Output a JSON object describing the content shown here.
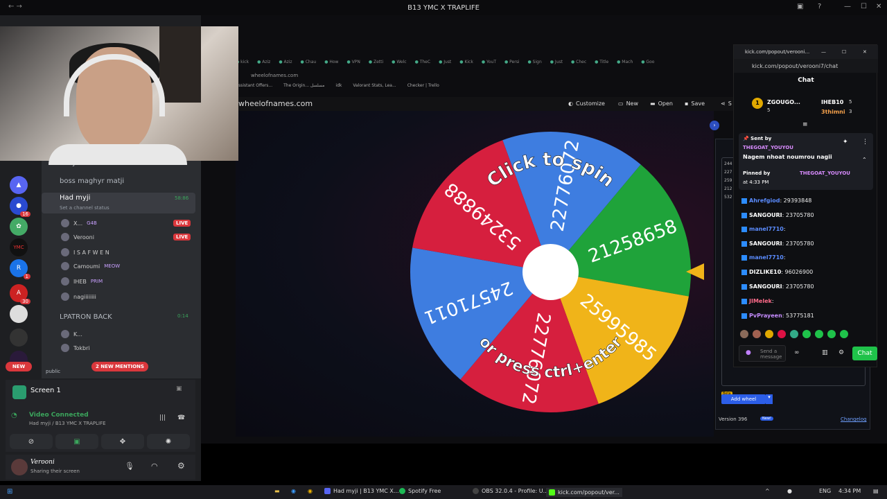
{
  "window": {
    "title": "B13 YMC X TRAPLIFE"
  },
  "discord": {
    "server_badges": [
      "16",
      "1",
      "30",
      "NEW"
    ],
    "channels": {
      "text1": "daily-task",
      "text2": "boss maghyr matji",
      "voice_active": "Had myji",
      "voice_active_time": "58:86",
      "voice_status": "Set a channel status",
      "voice2": "LPATRON BACK",
      "voice2_time": "0:14",
      "category": "public",
      "mentions": "2 NEW MENTIONS"
    },
    "users": [
      {
        "name": "X...",
        "tag": "G4B",
        "live": "LIVE"
      },
      {
        "name": "Verooni",
        "live": "LIVE"
      },
      {
        "name": "I S A F W E N"
      },
      {
        "name": "Camoumi",
        "tag": "MEOW"
      },
      {
        "name": "IHEB",
        "tag": "PRIM"
      },
      {
        "name": "nagiiiiiiii"
      },
      {
        "name": "K..."
      },
      {
        "name": "Tokbri"
      }
    ],
    "screen": {
      "label": "Screen 1"
    },
    "voice": {
      "status": "Video Connected",
      "channel": "Had myji / B13 YMC X TRAPLIFE"
    },
    "account": {
      "name": "Verooni",
      "status": "Sharing their screen"
    }
  },
  "browser": {
    "address": "wheelofnames.com",
    "tabs": [
      "kick",
      "Aziz",
      "Aziz",
      "Chau",
      "How",
      "VPN",
      "Zetti",
      "Welc",
      "TheC",
      "Just",
      "Kick",
      "YouT",
      "Persi",
      "Sign",
      "Just",
      "Chec",
      "Title",
      "Mach",
      "Goo"
    ],
    "bookmarks": [
      "Assistant Offers...",
      "The Origin... مسلسل",
      "idk",
      "Valorant Stats, Lea...",
      "Checker | Trello"
    ],
    "toolbar": {
      "customize": "Customize",
      "new": "New",
      "open": "Open",
      "save": "Save",
      "share": "S"
    }
  },
  "wheel": {
    "top_text": "Click to spin",
    "bottom_text": "or press ctrl+enter",
    "segments": [
      {
        "label": "22776072",
        "color": "#3e7de0"
      },
      {
        "label": "21258658",
        "color": "#1fa33a"
      },
      {
        "label": "25995985",
        "color": "#f0b419"
      },
      {
        "label": "22776072",
        "color": "#d61f3e"
      },
      {
        "label": "24571011",
        "color": "#3e7de0"
      },
      {
        "label": "53249888",
        "color": "#d61f3e"
      }
    ],
    "side_numbers": [
      "244",
      "227",
      "259",
      "212",
      "532"
    ]
  },
  "side": {
    "add_wheel": "Add wheel",
    "beta": "Beta",
    "version": "Version 396",
    "new_badge": "New!",
    "changelog": "Changelog"
  },
  "chat": {
    "window_url_short": "kick.com/popout/verooni...",
    "url": "kick.com/popout/verooni7/chat",
    "title": "Chat",
    "leaderboard": [
      {
        "name": "ZGOUGO...",
        "count": "5"
      },
      {
        "name": "IHEB10",
        "count": "5"
      },
      {
        "name": "3thimni",
        "count": "3"
      }
    ],
    "pinned": {
      "sent_by_label": "Sent by",
      "sender": "THEGOAT_YOUYOU",
      "text": "Nagem nhoat noumrou nagii",
      "pinned_by_label": "Pinned by",
      "pinned_by": "THEGOAT_YOUYOU",
      "time": "at 4:33 PM"
    },
    "messages": [
      {
        "user": "Ahrefgiod",
        "text": ": 29393848",
        "color": "#5b8cff"
      },
      {
        "user": "SANGOURI",
        "text": ": 23705780",
        "color": "#ffffff"
      },
      {
        "user": "manel7710",
        "text": ":",
        "color": "#5b8cff"
      },
      {
        "user": "SANGOURI",
        "text": ": 23705780",
        "color": "#ffffff"
      },
      {
        "user": "manel7710",
        "text": ":",
        "color": "#5b8cff"
      },
      {
        "user": "DIZLIKE10",
        "text": ": 96026900",
        "color": "#ffffff"
      },
      {
        "user": "SANGOURI",
        "text": ": 23705780",
        "color": "#ffffff"
      },
      {
        "user": "JIMelek",
        "text": ":",
        "color": "#ff6b8a"
      },
      {
        "user": "PvPrayeen",
        "text": ": 53775181",
        "color": "#c58cff"
      }
    ],
    "input_placeholder": "Send a message",
    "send": "Chat"
  },
  "taskbar": {
    "items": [
      "Had myji | B13 YMC X...",
      "Spotify Free",
      "OBS 32.0.4 - Profile: U...",
      "kick.com/popout/ver..."
    ],
    "lang": "ENG",
    "time": "4:34 PM"
  },
  "colors": {
    "kick_green": "#53fc18",
    "discord_bg": "#1e1f22",
    "live_red": "#da373c"
  }
}
